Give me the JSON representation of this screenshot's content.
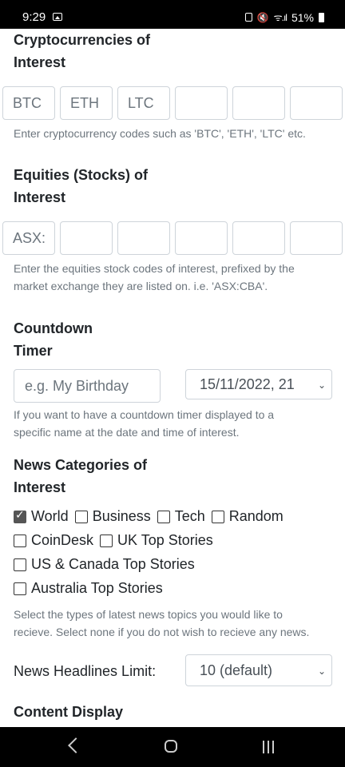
{
  "status_bar": {
    "time": "9:29",
    "battery": "51%"
  },
  "crypto": {
    "title_line1": "Cryptocurrencies of",
    "title_line2": "Interest",
    "codes": [
      "BTC",
      "ETH",
      "LTC",
      "",
      "",
      ""
    ],
    "help": "Enter cryptocurrency codes such as 'BTC', 'ETH', 'LTC' etc."
  },
  "equities": {
    "title_line1": "Equities (Stocks) of",
    "title_line2": "Interest",
    "codes": [
      "ASX:",
      "",
      "",
      "",
      "",
      ""
    ],
    "help_line1": "Enter the equities stock codes of interest, prefixed by the",
    "help_line2": "market exchange they are listed on. i.e. 'ASX:CBA'."
  },
  "countdown": {
    "title_line1": "Countdown",
    "title_line2": "Timer",
    "name_placeholder": "e.g. My Birthday",
    "datetime_value": "15/11/2022, 21",
    "help_line1": "If you want to have a countdown timer displayed to a",
    "help_line2": "specific name at the date and time of interest."
  },
  "news": {
    "title_line1": "News Categories of",
    "title_line2": "Interest",
    "rows": [
      [
        {
          "label": "World",
          "checked": true
        },
        {
          "label": "Business",
          "checked": false
        },
        {
          "label": "Tech",
          "checked": false
        },
        {
          "label": "Random",
          "checked": false
        }
      ],
      [
        {
          "label": "CoinDesk",
          "checked": false
        },
        {
          "label": "UK Top Stories",
          "checked": false
        }
      ],
      [
        {
          "label": "US & Canada Top Stories",
          "checked": false
        }
      ],
      [
        {
          "label": "Australia Top Stories",
          "checked": false
        }
      ]
    ],
    "help_line1": "Select the types of latest news topics you would like to",
    "help_line2": "recieve. Select none if you do not wish to recieve any news."
  },
  "headlines": {
    "label": "News Headlines Limit:",
    "value": "10 (default)"
  },
  "content_display": {
    "title": "Content Display"
  }
}
